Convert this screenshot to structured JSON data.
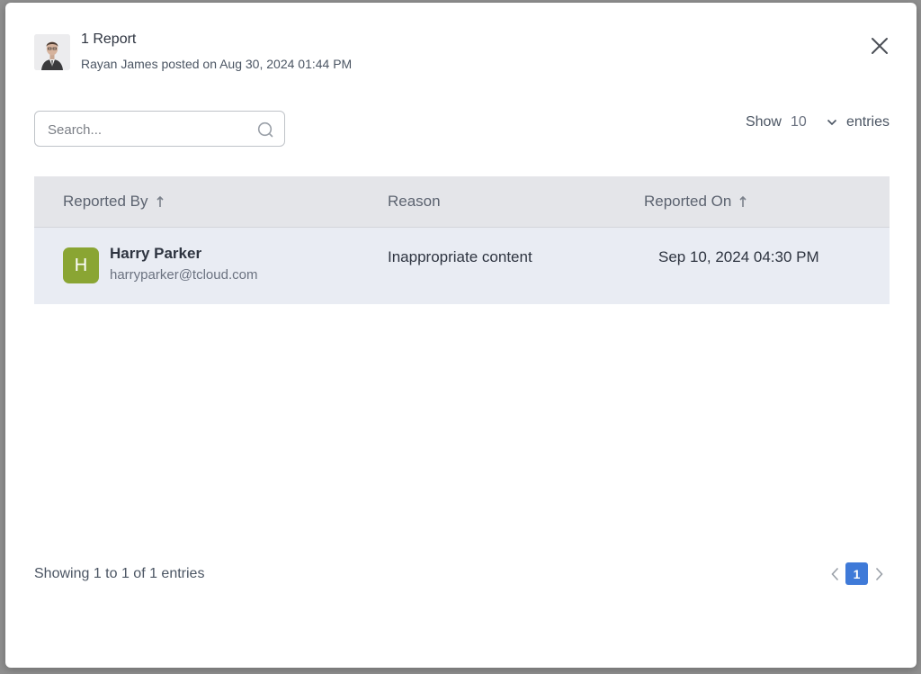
{
  "post": {
    "title": "1 Report",
    "subtitle": "Rayan James posted on Aug 30, 2024 01:44 PM"
  },
  "search": {
    "placeholder": "Search..."
  },
  "entries": {
    "show_label": "Show",
    "value": "10",
    "suffix": "entries"
  },
  "table": {
    "columns": [
      "Reported By",
      "Reason",
      "Reported On"
    ],
    "rows": [
      {
        "initial": "H",
        "name": "Harry Parker",
        "email": "harryparker@tcloud.com",
        "reason": "Inappropriate content",
        "reported_on": "Sep 10, 2024 04:30 PM"
      }
    ]
  },
  "footer": {
    "info": "Showing 1 to 1 of 1 entries",
    "current_page": "1"
  },
  "colors": {
    "accent": "#3f7ad8",
    "avatar": "#8aa533",
    "header_bg": "#e4e5e9",
    "row_bg": "#e9ecf3"
  },
  "icons": {
    "close": "close-icon",
    "search": "search-icon",
    "sort": "sort-arrow-icon",
    "dropdown": "chevron-down-icon",
    "prev": "chevron-left-icon",
    "next": "chevron-right-icon"
  }
}
